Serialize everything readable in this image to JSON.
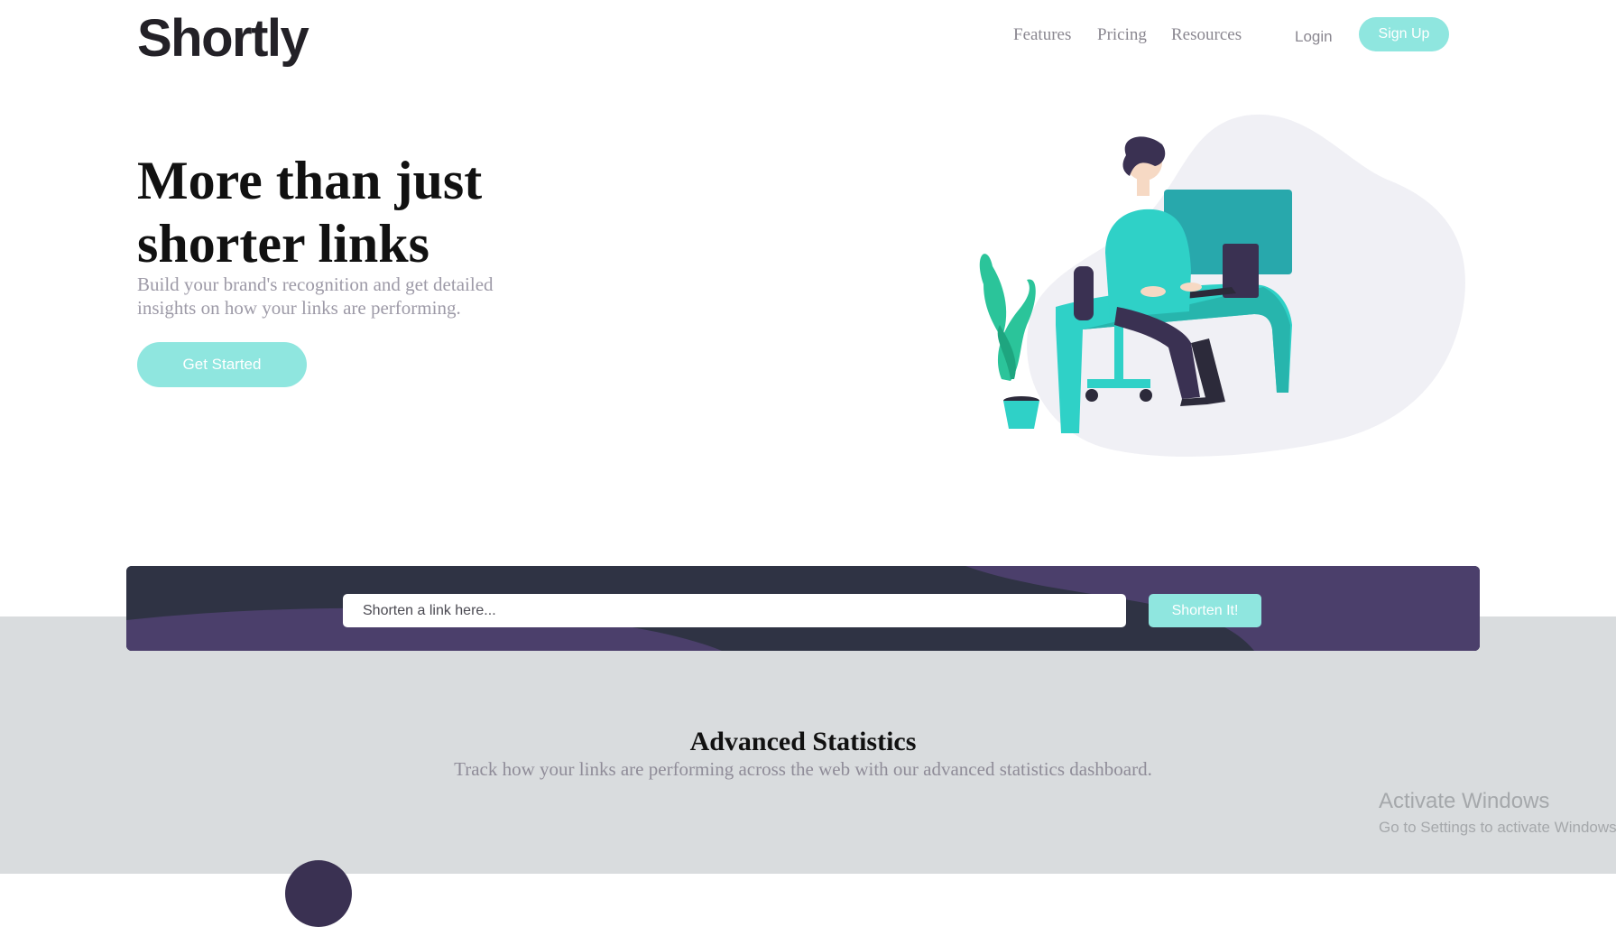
{
  "header": {
    "logo": "Shortly",
    "nav": [
      "Features",
      "Pricing",
      "Resources"
    ],
    "login": "Login",
    "signup": "Sign Up"
  },
  "hero": {
    "title": "More than just shorter links",
    "subtitle": "Build your brand's recognition and get detailed insights on how your links are performing.",
    "cta": "Get Started",
    "illustration_icon": "person-working-at-desk-illustration"
  },
  "shorten": {
    "placeholder": "Shorten a link here...",
    "button": "Shorten It!"
  },
  "stats": {
    "title": "Advanced Statistics",
    "subtitle": "Track how your links are performing across the web with our advanced statistics dashboard."
  },
  "watermark": {
    "title": "Activate Windows",
    "subtitle": "Go to Settings to activate Windows."
  },
  "colors": {
    "primary": "#8fe6df",
    "dark_violet": "#3a3152",
    "dark_navy": "#232127",
    "gray_section": "#d9dcde"
  }
}
